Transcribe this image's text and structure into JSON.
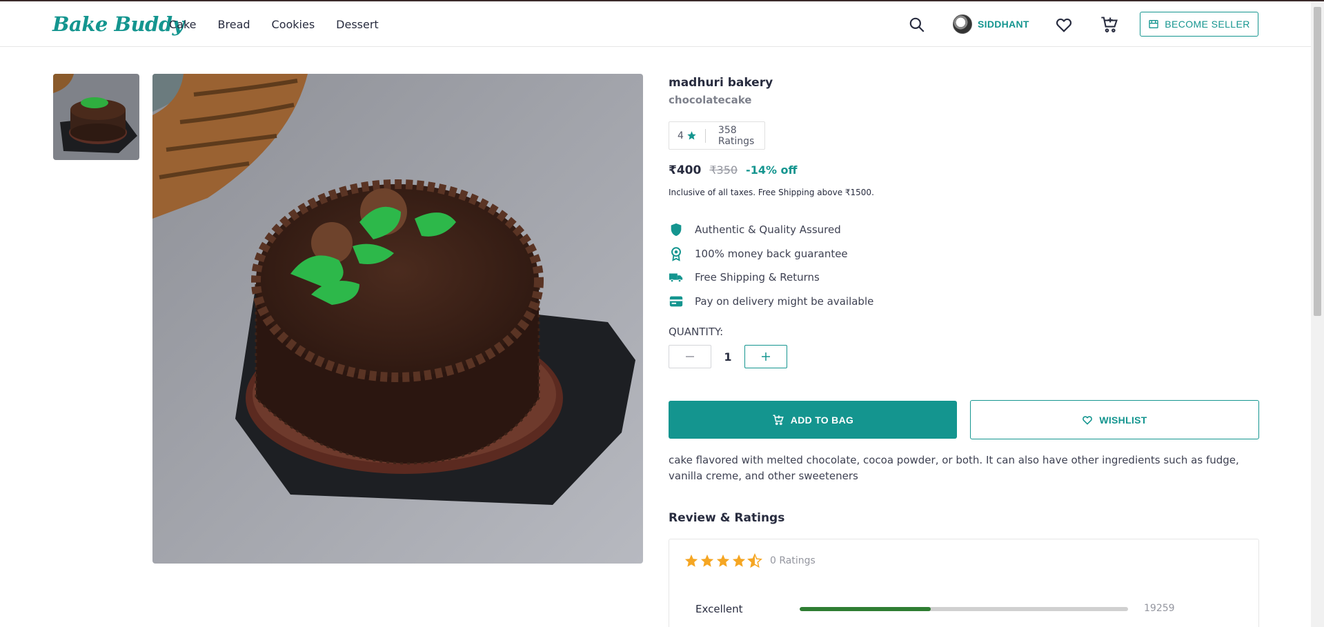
{
  "header": {
    "logo": "Bake Buddy",
    "nav": [
      "Cake",
      "Bread",
      "Cookies",
      "Dessert"
    ],
    "username": "SIDDHANT",
    "seller_label": "BECOME SELLER"
  },
  "product": {
    "brand": "madhuri bakery",
    "name": "chocolatecake",
    "rating": "4",
    "ratings_count": "358 Ratings",
    "price": "₹400",
    "mrp": "₹350",
    "discount": "-14% off",
    "tax_note": "Inclusive of all taxes. Free Shipping above ₹1500.",
    "features": [
      {
        "icon": "shield-icon",
        "label": "Authentic & Quality Assured"
      },
      {
        "icon": "badge-icon",
        "label": "100% money back guarantee"
      },
      {
        "icon": "truck-icon",
        "label": "Free Shipping & Returns"
      },
      {
        "icon": "card-icon",
        "label": "Pay on delivery might be available"
      }
    ],
    "quantity_label": "QUANTITY:",
    "quantity": "1",
    "add_to_bag": "ADD TO BAG",
    "wishlist": "WISHLIST",
    "description": "cake flavored with melted chocolate, cocoa powder, or both. It can also have other ingredients such as fudge, vanilla creme, and other sweeteners"
  },
  "reviews": {
    "title": "Review & Ratings",
    "star_rating": 4.5,
    "count": "0 Ratings",
    "breakdown": [
      {
        "label": "Excellent",
        "fraction": 0.4,
        "count": "19259"
      }
    ]
  },
  "colors": {
    "accent": "#14958f",
    "star": "#f5a623",
    "bar": "#2e7d32"
  }
}
